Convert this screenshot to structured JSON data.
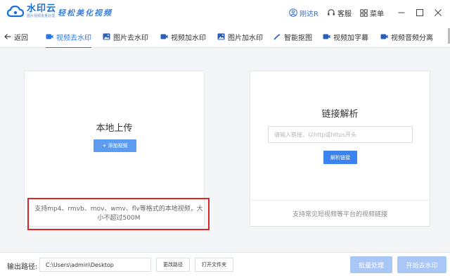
{
  "app": {
    "name": "水印云",
    "subtitle": "图片视频批量处理",
    "slogan": "轻松美化视频"
  },
  "titlebar": {
    "user_label": "刚达R",
    "service_label": "客服",
    "menu_label": "菜单"
  },
  "nav": {
    "back_label": "返回",
    "tabs": [
      {
        "label": "视频去水印",
        "icon": "video-icon",
        "active": true
      },
      {
        "label": "图片去水印",
        "icon": "image-icon",
        "active": false
      },
      {
        "label": "视频加水印",
        "icon": "video-icon",
        "active": false
      },
      {
        "label": "图片加水印",
        "icon": "image-icon",
        "active": false
      },
      {
        "label": "智能抠图",
        "icon": "magic-wand-icon",
        "active": false
      },
      {
        "label": "视频加字幕",
        "icon": "video-icon",
        "active": false
      },
      {
        "label": "视频音频分离",
        "icon": "video-icon",
        "active": false
      }
    ]
  },
  "upload": {
    "title": "本地上传",
    "add_button": "+ 添加视频",
    "formats_note": "支持mp4、rmvb、mov、wmv、flv等格式的本地视频，大小不超过500M"
  },
  "link_parse": {
    "title": "链接解析",
    "input_placeholder": "请输入链接，以http或https开头",
    "input_value": "",
    "parse_button": "解析链接",
    "platform_note": "支持常见短视频等平台的视频链接"
  },
  "bottom": {
    "output_label": "输出路径:",
    "output_path": "C:\\Users\\admin\\Desktop",
    "change_path_button": "更改路径",
    "open_folder_button": "打开文件夹",
    "batch_button": "批量处理",
    "start_button": "开始去水印"
  },
  "colors": {
    "accent": "#2b78e4",
    "button_primary": "#3b84f0",
    "button_disabled": "#a8c7f6",
    "highlight_border": "#d9262a",
    "background": "#f4f5f7"
  }
}
